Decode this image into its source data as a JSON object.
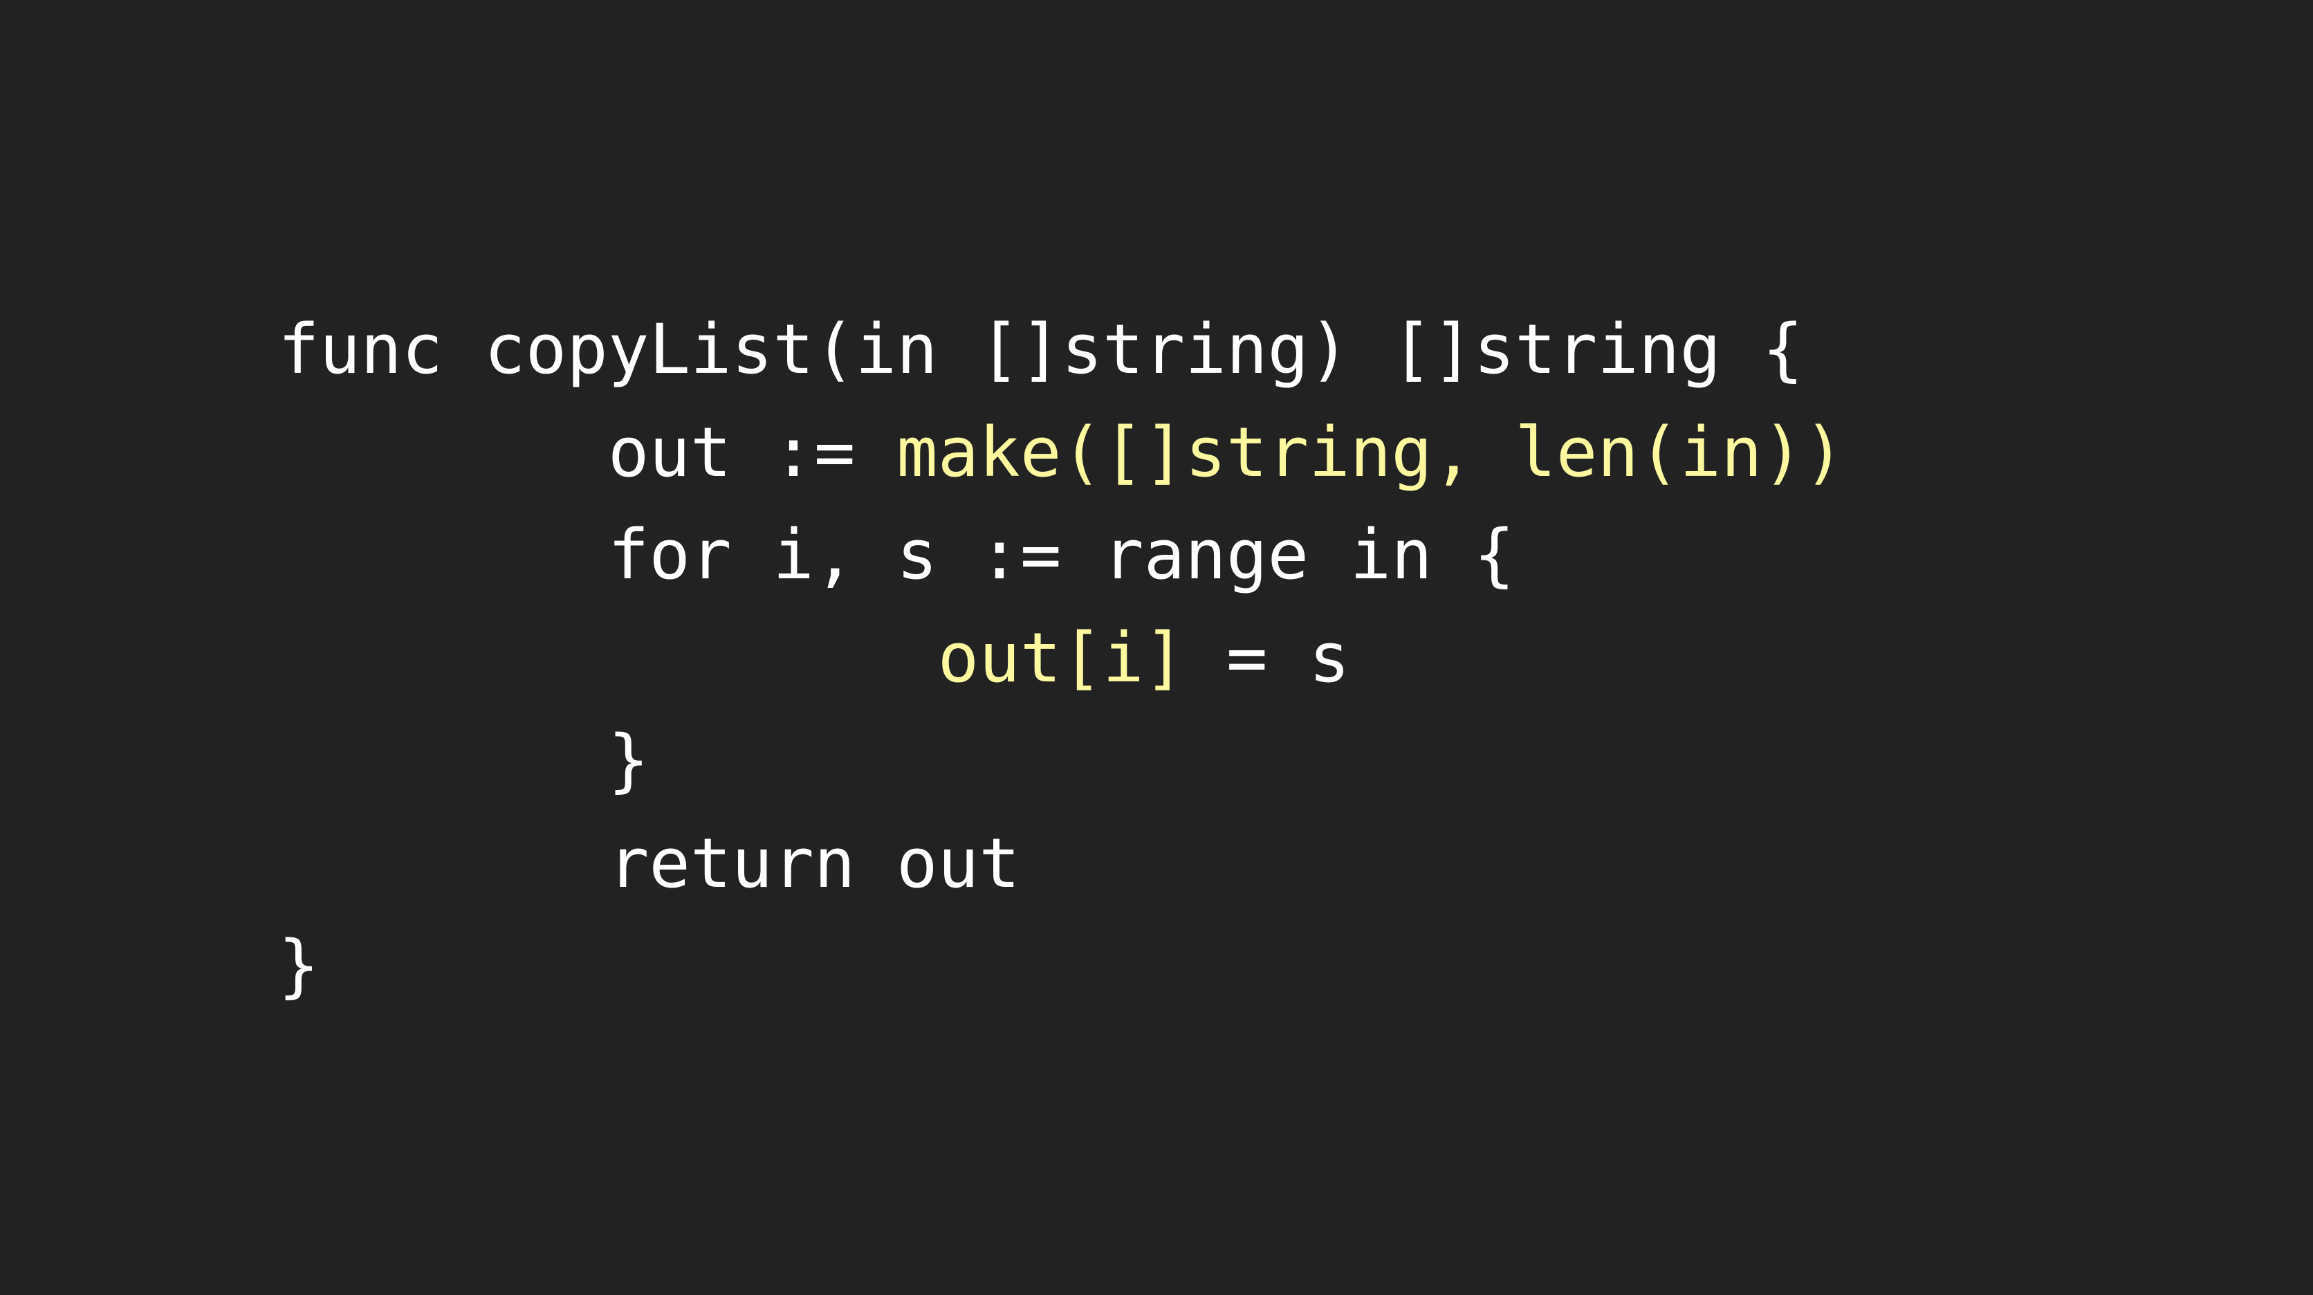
{
  "colors": {
    "background": "#222222",
    "text": "#ffffff",
    "highlight": "#fbf8a0"
  },
  "code": {
    "language": "go",
    "line1": "func copyList(in []string) []string {",
    "line2_indent": "\t",
    "line2_plain": "out := ",
    "line2_highlight": "make([]string, len(in))",
    "line3_indent": "\t",
    "line3": "for i, s := range in {",
    "line4_indent": "\t\t",
    "line4_highlight": "out[i]",
    "line4_plain": " = s",
    "line5_indent": "\t",
    "line5": "}",
    "line6_indent": "\t",
    "line6": "return out",
    "line7": "}"
  }
}
